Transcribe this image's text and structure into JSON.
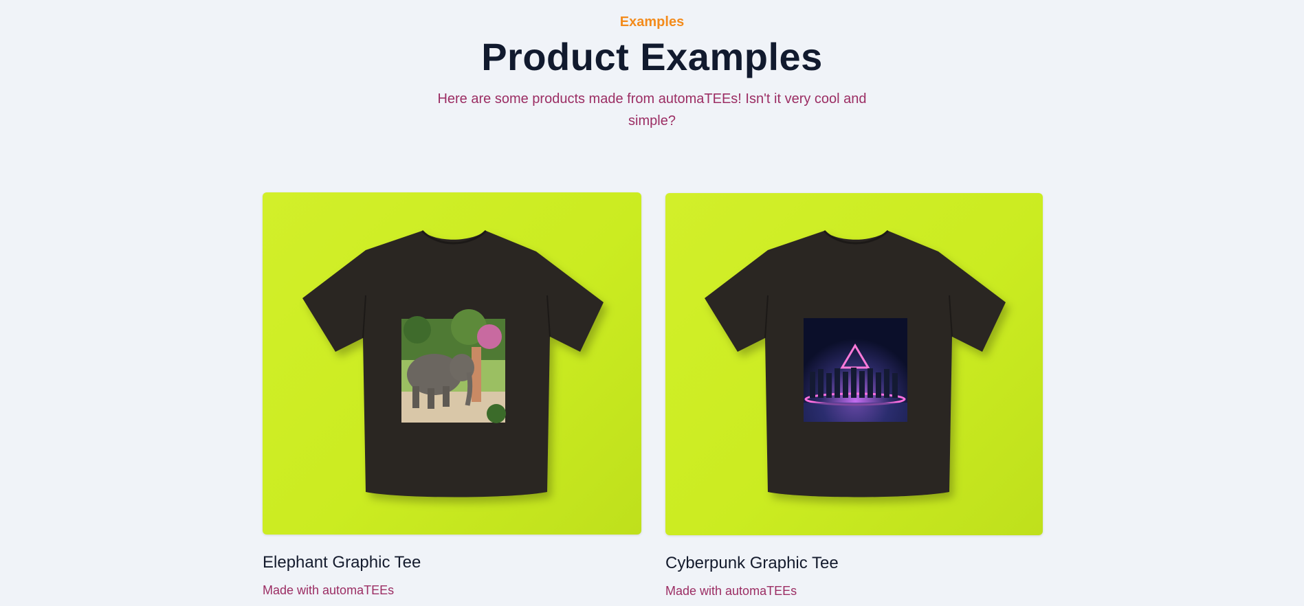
{
  "header": {
    "eyebrow": "Examples",
    "title": "Product Examples",
    "subtitle": "Here are some products made from automaTEEs! Isn't it very cool and simple?"
  },
  "products": [
    {
      "title": "Elephant Graphic Tee",
      "subtitle": "Made with automaTEEs",
      "print_image": "elephant-photo",
      "background_color": "#cbec21",
      "shirt_color": "#2a2623"
    },
    {
      "title": "Cyberpunk Graphic Tee",
      "subtitle": "Made with automaTEEs",
      "print_image": "cyberpunk-neon-triangle",
      "background_color": "#cbec21",
      "shirt_color": "#2a2623"
    }
  ],
  "colors": {
    "background": "#f0f3f8",
    "accent": "#f38b1c",
    "heading": "#111a2e",
    "muted_link": "#9b2d63"
  }
}
